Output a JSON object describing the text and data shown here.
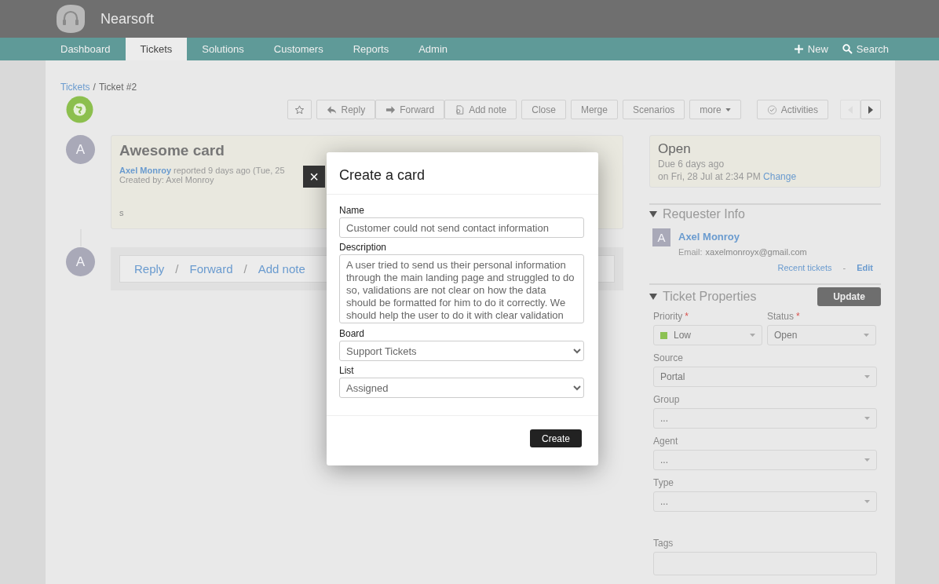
{
  "app": {
    "name": "Nearsoft"
  },
  "nav": {
    "tabs": [
      {
        "label": "Dashboard",
        "selected": false
      },
      {
        "label": "Tickets",
        "selected": true
      },
      {
        "label": "Solutions",
        "selected": false
      },
      {
        "label": "Customers",
        "selected": false
      },
      {
        "label": "Reports",
        "selected": false
      },
      {
        "label": "Admin",
        "selected": false
      }
    ],
    "actions": [
      {
        "kind": "new",
        "label": "New"
      },
      {
        "kind": "search",
        "label": "Search"
      }
    ]
  },
  "breadcrumb": {
    "link": "Tickets",
    "separator": "/",
    "current": "Ticket #2"
  },
  "toolbar": {
    "buttons": [
      {
        "kind": "star"
      },
      {
        "kind": "reply",
        "label": "Reply"
      },
      {
        "kind": "forward",
        "label": "Forward"
      },
      {
        "kind": "note",
        "label": "Add note"
      },
      {
        "kind": "plain",
        "label": "Close"
      },
      {
        "kind": "plain",
        "label": "Merge"
      },
      {
        "kind": "plain",
        "label": "Scenarios"
      },
      {
        "kind": "dropdown",
        "label": "more"
      },
      {
        "kind": "check",
        "label": "Activities"
      },
      {
        "kind": "prev",
        "disabled": true
      },
      {
        "kind": "next",
        "disabled": false
      }
    ]
  },
  "ticket": {
    "avatar_letter": "A",
    "title": "Awesome card",
    "author": "Axel Monroy",
    "reported": "reported 9 days ago (Tue, 25",
    "created_by": "Created by: Axel Monroy",
    "body": "s"
  },
  "reply_box": {
    "avatar_letter": "A",
    "links": [
      "Reply",
      "Forward",
      "Add note"
    ],
    "separator": "/"
  },
  "status_card": {
    "status": "Open",
    "due": "Due 6 days ago",
    "due_date": "on Fri, 28 Jul at 2:34 PM",
    "change_link": "Change"
  },
  "requester": {
    "title": "Requester Info",
    "expanded": true,
    "avatar_letter": "A",
    "name": "Axel Monroy",
    "email_label": "Email:",
    "email": "xaxelmonroyx@gmail.com",
    "links": [
      "Recent tickets",
      "Edit"
    ],
    "link_separator": "-"
  },
  "properties": {
    "title": "Ticket Properties",
    "expanded": true,
    "update_button": "Update",
    "required_mark": "*",
    "fields": [
      {
        "kind": "select",
        "label": "Priority",
        "required": true,
        "value": "Low",
        "color": "#8cc152"
      },
      {
        "kind": "select",
        "label": "Status",
        "required": true,
        "value": "Open"
      },
      {
        "kind": "select",
        "label": "Source",
        "required": false,
        "value": "Portal"
      },
      {
        "kind": "select",
        "label": "Group",
        "required": false,
        "value": "..."
      },
      {
        "kind": "select",
        "label": "Agent",
        "required": false,
        "value": "..."
      },
      {
        "kind": "select",
        "label": "Type",
        "required": false,
        "value": "..."
      },
      {
        "kind": "tags",
        "label": "Tags",
        "required": false
      }
    ]
  },
  "modal": {
    "close": "×",
    "title": "Create a card",
    "submit": "Create",
    "fields": [
      {
        "kind": "text",
        "label": "Name",
        "value": "Customer could not send contact information"
      },
      {
        "kind": "textarea",
        "label": "Description",
        "value": "A user tried to send us their personal information through the main landing page and struggled to do so, validations are not clear on how the data should be formatted for him to do it correctly. We should help the user to do it with clear validation"
      },
      {
        "kind": "select",
        "label": "Board",
        "value": "Support Tickets"
      },
      {
        "kind": "select",
        "label": "List",
        "value": "Assigned"
      }
    ]
  }
}
